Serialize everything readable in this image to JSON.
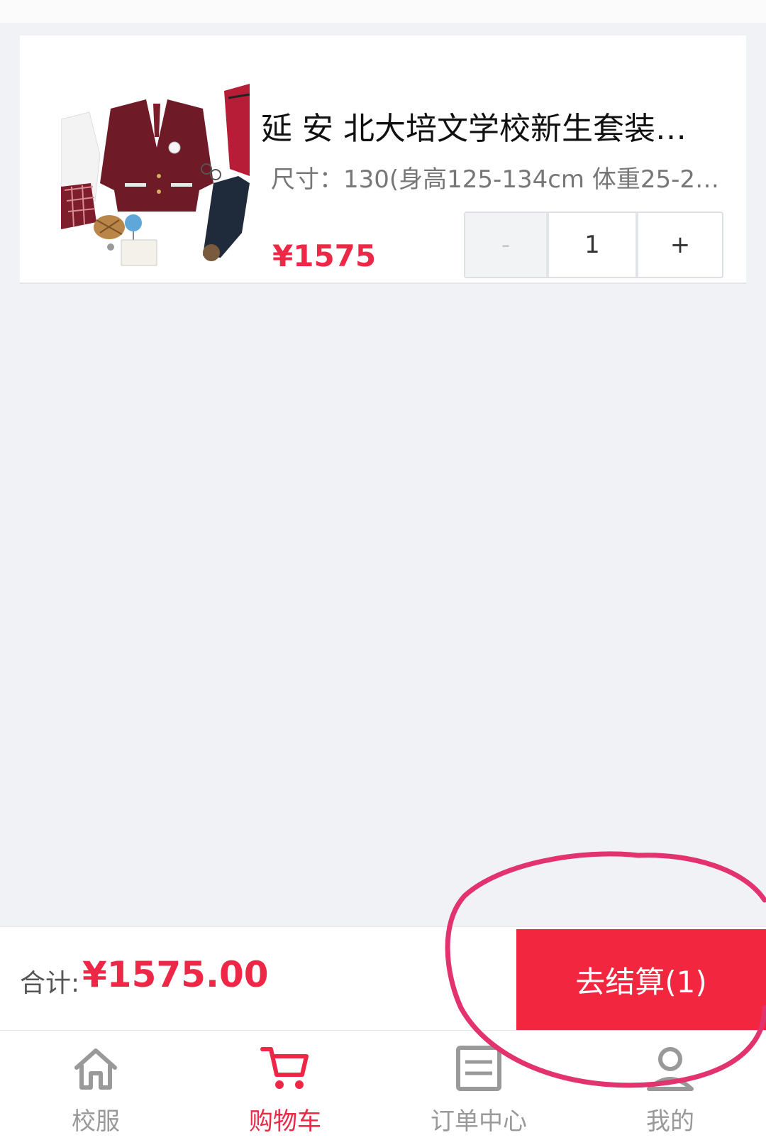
{
  "cart_item": {
    "title": "延 安 北大培文学校新生套装…",
    "spec": "尺寸：130(身高125-134cm 体重25-29…",
    "price": "¥1575",
    "quantity": "1",
    "minus_label": "-",
    "plus_label": "+",
    "image_icon": "school-uniform-photo"
  },
  "checkout": {
    "total_label": "合计:",
    "total_amount": "¥1575.00",
    "button_label": "去结算(1)"
  },
  "tabbar": {
    "items": [
      {
        "label": "校服",
        "icon": "home-icon",
        "active": false
      },
      {
        "label": "购物车",
        "icon": "cart-icon",
        "active": true
      },
      {
        "label": "订单中心",
        "icon": "order-icon",
        "active": false
      },
      {
        "label": "我的",
        "icon": "user-icon",
        "active": false
      }
    ]
  },
  "colors": {
    "accent": "#ee2746",
    "checkout_button": "#f2273f",
    "annotation_circle": "#e2336f",
    "inactive_tab": "#999999"
  }
}
